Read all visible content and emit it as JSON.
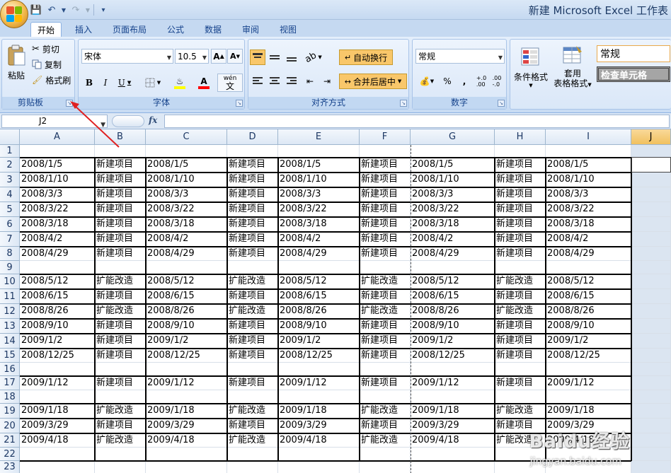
{
  "window": {
    "title": "新建 Microsoft Excel 工作表"
  },
  "ribbon_tabs": [
    "开始",
    "插入",
    "页面布局",
    "公式",
    "数据",
    "审阅",
    "视图"
  ],
  "clipboard": {
    "paste_label": "粘贴",
    "cut_label": "剪切",
    "copy_label": "复制",
    "format_painter_label": "格式刷",
    "group_label": "剪贴板"
  },
  "font": {
    "name": "宋体",
    "size": "10.5",
    "grow_label": "A",
    "shrink_label": "A",
    "bold_label": "B",
    "italic_label": "I",
    "underline_label": "U",
    "font_color_label": "A",
    "phonetic_label": "wén",
    "group_label": "字体"
  },
  "alignment": {
    "wrap_text_label": "自动换行",
    "merge_center_label": "合并后居中",
    "group_label": "对齐方式"
  },
  "number": {
    "format": "常规",
    "percent_label": "%",
    "comma_label": ",",
    "group_label": "数字"
  },
  "styles": {
    "conditional_format_label": "条件格式",
    "table_format_label_1": "套用",
    "table_format_label_2": "表格格式",
    "style_normal": "常规",
    "style_check_cell": "检查单元格"
  },
  "formula_bar": {
    "name_box": "J2",
    "fx_label": "fx",
    "formula": ""
  },
  "sheet": {
    "columns": [
      "A",
      "B",
      "C",
      "D",
      "E",
      "F",
      "G",
      "H",
      "I",
      "J"
    ],
    "selected_column": "J",
    "row_numbers": [
      "1",
      "2",
      "3",
      "4",
      "5",
      "6",
      "7",
      "8",
      "9",
      "10",
      "11",
      "12",
      "13",
      "14",
      "15",
      "16",
      "17",
      "18",
      "19",
      "20",
      "21",
      "22",
      "23"
    ],
    "records": [
      {
        "date": "2008/1/5",
        "type": "新建项目"
      },
      {
        "date": "2008/1/10",
        "type": "新建项目"
      },
      {
        "date": "2008/3/3",
        "type": "新建项目"
      },
      {
        "date": "2008/3/22",
        "type": "新建项目"
      },
      {
        "date": "2008/3/18",
        "type": "新建项目"
      },
      {
        "date": "2008/4/2",
        "type": "新建项目"
      },
      {
        "date": "2008/4/29",
        "type": "新建项目"
      },
      {
        "date": "2008/5/12",
        "type": "扩能改造"
      },
      {
        "date": "2008/6/15",
        "type": "新建项目"
      },
      {
        "date": "2008/8/26",
        "type": "扩能改造"
      },
      {
        "date": "2008/9/10",
        "type": "新建项目"
      },
      {
        "date": "2009/1/2",
        "type": "新建项目"
      },
      {
        "date": "2008/12/25",
        "type": "新建项目"
      },
      {
        "date": "2009/1/12",
        "type": "新建项目"
      },
      {
        "date": "2009/1/18",
        "type": "扩能改造"
      },
      {
        "date": "2009/3/29",
        "type": "新建项目"
      },
      {
        "date": "2009/4/18",
        "type": "扩能改造"
      }
    ]
  },
  "watermark": {
    "text": "Baidu经验",
    "url": "jingyan.baidu.com"
  },
  "colors": {
    "ribbon_bg": "#d3e3f6",
    "selected_header": "#f1c15f",
    "wrap_highlight": "#f9c76a",
    "annotation_arrow": "#e02020"
  }
}
